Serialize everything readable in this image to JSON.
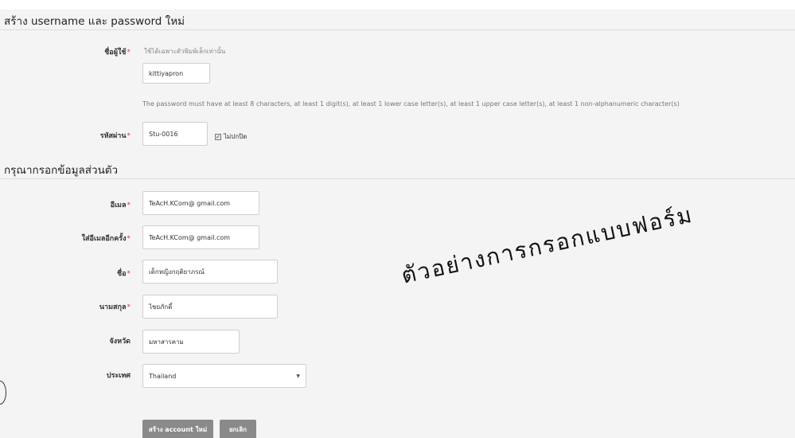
{
  "sections": {
    "account_title": "สร้าง username และ password ใหม่",
    "personal_title": "กรุณากรอกข้อมูลส่วนตัว"
  },
  "account": {
    "username_label": "ชื่อผู้ใช้",
    "username_hint": "ใช้ได้เฉพาะตัวพิมพ์เล็กเท่านั้น",
    "username_value": "kittiyapron",
    "password_rule": "The password must have at least 8 characters, at least 1 digit(s), at least 1 lower case letter(s), at least 1 upper case letter(s), at least 1 non-alphanumeric character(s)",
    "password_label": "รหัสผ่าน",
    "password_value": "Stu-0016",
    "unmask_label": "ไม่ปกปิด",
    "unmask_checked": true
  },
  "personal": {
    "email_label": "อีเมล",
    "email_value": "TeAcH.KCom@ gmail.com",
    "email_again_label": "ใส่อีเมลอีกครั้ง",
    "email_again_value": "TeAcH.KCom@ gmail.com",
    "firstname_label": "ชื่อ",
    "firstname_value": "เด็กหญิงกฤติยาภรณ์",
    "lastname_label": "นามสกุล",
    "lastname_value": "ไชยภักดิ์",
    "city_label": "จังหวัด",
    "city_value": "มหาสารคาม",
    "country_label": "ประเทศ",
    "country_value": "Thailand"
  },
  "buttons": {
    "create": "สร้าง account ใหม่",
    "cancel": "ยกเลิก"
  },
  "required_marker": "*",
  "annotation": "ตัวอย่างการกรอกแบบฟอร์ม"
}
